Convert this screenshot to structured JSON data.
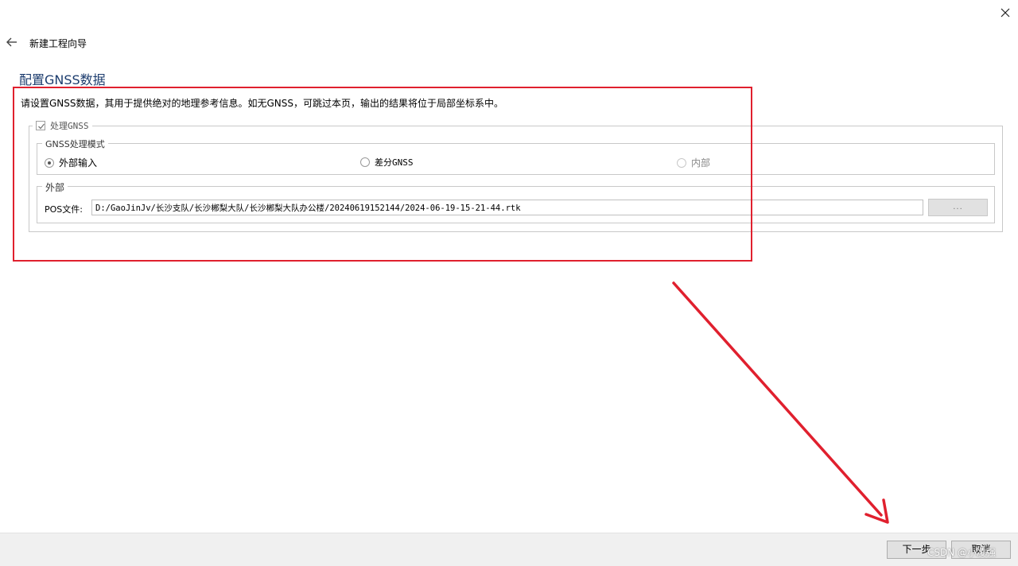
{
  "window": {
    "title": "新建工程向导",
    "icons": {
      "close": "close-icon",
      "back": "back-arrow-icon"
    }
  },
  "page": {
    "title": "配置GNSS数据",
    "description": "请设置GNSS数据，其用于提供绝对的地理参考信息。如无GNSS，可跳过本页，输出的结果将位于局部坐标系中。"
  },
  "gnss_group": {
    "checkbox_label": "处理GNSS",
    "checked": true,
    "mode_group": {
      "label": "GNSS处理模式",
      "options": [
        {
          "label": "外部输入",
          "selected": true,
          "enabled": true
        },
        {
          "label": "差分GNSS",
          "selected": false,
          "enabled": true
        },
        {
          "label": "内部",
          "selected": false,
          "enabled": false
        }
      ]
    },
    "external_group": {
      "label": "外部",
      "pos_label": "POS文件:",
      "pos_value": "D:/GaoJinJv/长沙支队/长沙郴梨大队/长沙郴梨大队办公楼/20240619152144/2024-06-19-15-21-44.rtk",
      "browse_label": "..."
    }
  },
  "annotations": {
    "highlight_color": "#e0202e",
    "arrow_color": "#e0202e"
  },
  "footer": {
    "next_label": "下一步",
    "cancel_label": "取消",
    "watermark": "CSDN @小凌强"
  }
}
